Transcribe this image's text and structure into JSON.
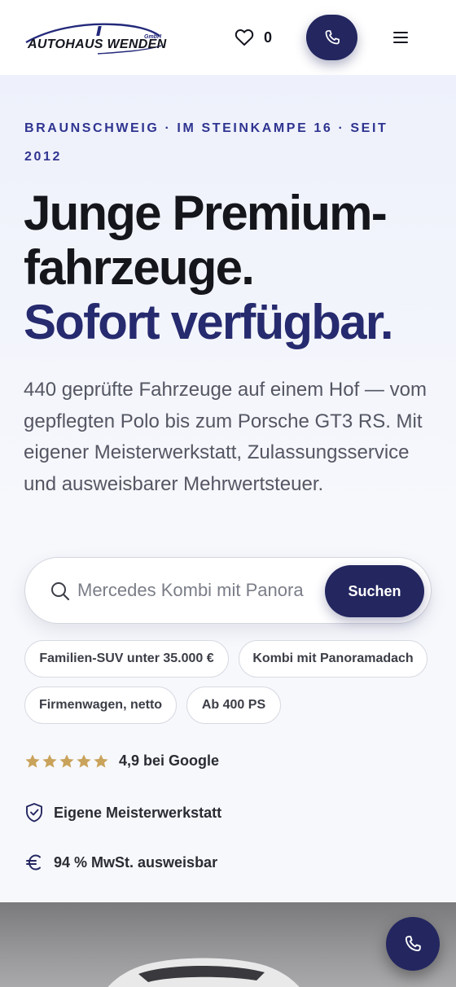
{
  "header": {
    "logo_text": "AUTOHAUS WENDEN",
    "logo_suffix": "GmbH",
    "favorites_count": "0",
    "phone_icon": "phone-icon",
    "menu_icon": "hamburger-menu-icon",
    "favorites_icon": "heart-icon"
  },
  "hero": {
    "eyebrow": "BRAUNSCHWEIG · IM STEINKAMPE 16 · SEIT 2012",
    "headline_line1": "Junge Premium-fahrzeuge.",
    "headline_accent": "Sofort verfügbar.",
    "intro": "440 geprüfte Fahrzeuge auf einem Hof — vom gepflegten Polo bis zum Porsche GT3 RS. Mit eigener Meisterwerkstatt, Zulassungsservice und ausweisbarer Mehrwertsteuer."
  },
  "search": {
    "placeholder": "Mercedes Kombi mit Panoramadach",
    "value": "",
    "button_label": "Suchen",
    "icon": "search-icon"
  },
  "suggestions": [
    "Familien-SUV unter 35.000 €",
    "Kombi mit Panoramadach",
    "Firmenwagen, netto",
    "Ab 400 PS"
  ],
  "trust": {
    "rating_stars": 5,
    "rating_label": "4,9 bei Google",
    "workshop_label": "Eigene Meisterwerkstatt",
    "vat_label": "94 % MwSt. ausweisbar",
    "workshop_icon": "shield-check-icon",
    "vat_icon": "euro-icon"
  },
  "colors": {
    "brand_navy": "#23265f",
    "eyebrow_blue": "#2f3490",
    "star_gold": "#c9a35b"
  }
}
